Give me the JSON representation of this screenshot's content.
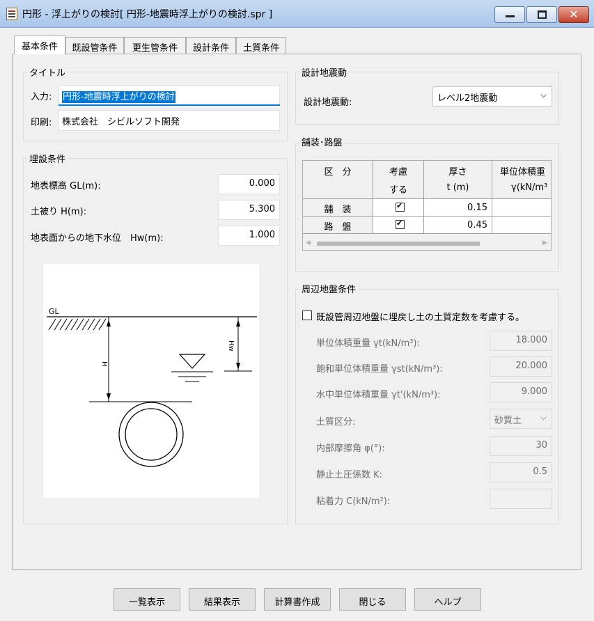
{
  "window": {
    "title": "円形 - 浮上がりの検討[ 円形-地震時浮上がりの検討.spr ]",
    "min_glyph": "",
    "close_glyph": "✕"
  },
  "tabs": [
    "基本条件",
    "既設管条件",
    "更生管条件",
    "設計条件",
    "土質条件"
  ],
  "title_group": {
    "label": "タイトル",
    "input_label": "入力:",
    "input_value": "円形-地震時浮上がりの検討",
    "print_label": "印刷:",
    "print_value": "株式会社　シビルソフト開発"
  },
  "burial": {
    "label": "埋設条件",
    "rows": [
      {
        "label": "地表標高 GL(m):",
        "value": "0.000"
      },
      {
        "label": "土被り H(m):",
        "value": "5.300"
      },
      {
        "label": "地表面からの地下水位　Hw(m):",
        "value": "1.000"
      }
    ]
  },
  "diagram": {
    "gl": "GL",
    "h": "H",
    "hw": "Hw"
  },
  "seismic": {
    "label": "設計地震動",
    "field_label": "設計地震動:",
    "value": "レベル2地震動"
  },
  "pavement": {
    "label": "舗装･路盤",
    "headers": [
      [
        "区　分",
        ""
      ],
      [
        "考慮",
        "する"
      ],
      [
        "厚さ",
        "t (m)"
      ],
      [
        "単位体積重",
        "γ(kN/m³"
      ]
    ],
    "rows": [
      {
        "name": "舗　装",
        "checked": true,
        "thickness": "0.15"
      },
      {
        "name": "路　盤",
        "checked": true,
        "thickness": "0.45"
      }
    ]
  },
  "surrounding": {
    "label": "周辺地盤条件",
    "checkbox_label": "既設管周辺地盤に埋戻し土の土質定数を考慮する。",
    "rows": [
      {
        "label": "単位体積重量 γt(kN/m³):",
        "value": "18.000"
      },
      {
        "label": "飽和単位体積重量 γst(kN/m³):",
        "value": "20.000"
      },
      {
        "label": "水中単位体積重量 γt'(kN/m³):",
        "value": "9.000"
      },
      {
        "label": "土質区分:",
        "value": "砂質土"
      },
      {
        "label": "内部摩擦角 φ(°):",
        "value": "30"
      },
      {
        "label": "静止土圧係数 K:",
        "value": "0.5"
      },
      {
        "label": "粘着力 C(kN/m²):",
        "value": ""
      }
    ]
  },
  "buttons": [
    "一覧表示",
    "結果表示",
    "計算書作成",
    "閉じる",
    "ヘルプ"
  ]
}
